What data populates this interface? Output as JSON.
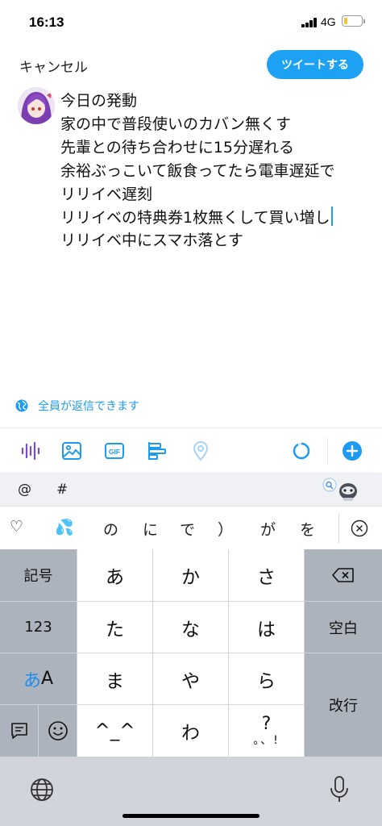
{
  "status_bar": {
    "time": "16:13",
    "network": "4G",
    "battery_level": 0.18
  },
  "header": {
    "cancel_label": "キャンセル",
    "tweet_label": "ツイートする"
  },
  "compose": {
    "lines": [
      "今日の発動",
      "家の中で普段使いのカバン無くす",
      "先輩との待ち合わせに15分遅れる",
      "余裕ぶっこいて飯食ってたら電車遅延で",
      "リリイベ遅刻",
      "リリイベの特典券1枚無くして買い増し",
      "リリイベ中にスマホ落とす"
    ]
  },
  "reply_setting": {
    "label": "全員が返信できます",
    "icon": "globe-icon"
  },
  "toolbar": {
    "icons": [
      "voice-icon",
      "image-icon",
      "gif-icon",
      "poll-icon",
      "location-icon",
      "character-count-ring",
      "add-thread-icon"
    ],
    "gif_text": "GIF"
  },
  "suggestion_bar": {
    "items": [
      "@",
      "#"
    ]
  },
  "candidates": {
    "items": [
      "♡",
      "💦",
      "の",
      "に",
      "で",
      "）",
      "が",
      "を"
    ]
  },
  "keyboard": {
    "row1": [
      "記号",
      "あ",
      "か",
      "さ"
    ],
    "row2": [
      "123",
      "た",
      "な",
      "は",
      "空白"
    ],
    "row3_left_a": "あ",
    "row3_left_A": "A",
    "row3": [
      "ま",
      "や",
      "ら"
    ],
    "row4": [
      "^_^",
      "わ"
    ],
    "row4_q_top": "?",
    "row4_q_bottom": "。、!",
    "enter_label": "改行"
  },
  "colors": {
    "accent": "#1da1f2",
    "keyboard_bg": "#d1d4da",
    "key_dark": "#adb3bc"
  }
}
